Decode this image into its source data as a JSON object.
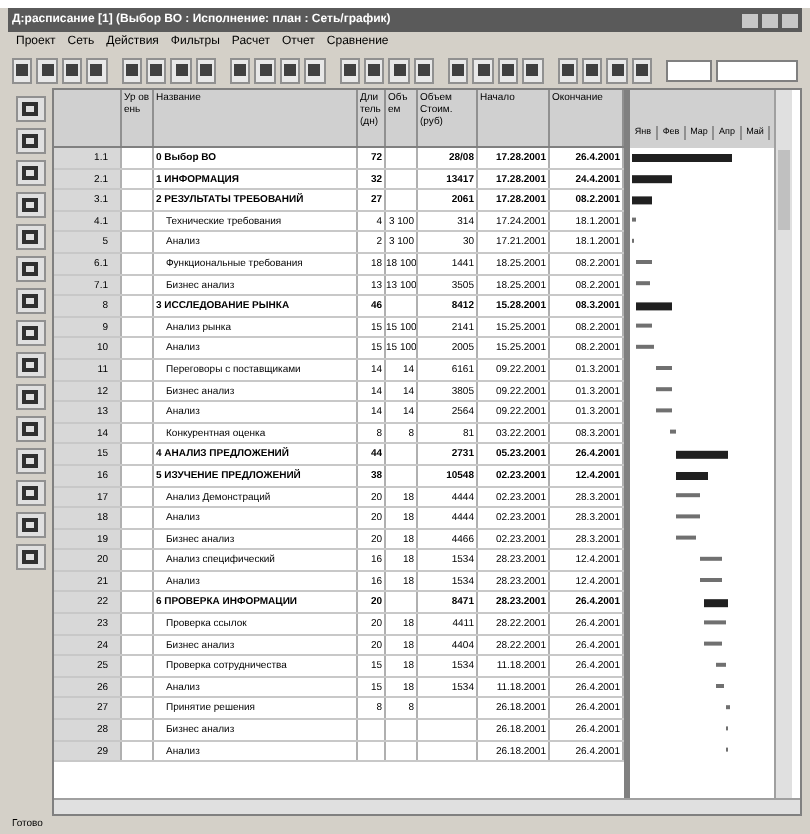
{
  "window": {
    "title": "Д:расписание [1]  (Выбор ВО : Исполнение: план : Сеть/график)"
  },
  "menu": [
    "Проект",
    "Сеть",
    "Действия",
    "Фильтры",
    "Расчет",
    "Отчет",
    "Сравнение"
  ],
  "columns": [
    "",
    "Ур ов ень",
    "Название",
    "Дли тель (дн)",
    "Объ ем",
    "Объем Стоим. (руб)",
    "Начало",
    "Окончание"
  ],
  "gantt_months": [
    "Янв",
    "Фев",
    "Мар",
    "Апр",
    "Май"
  ],
  "rows": [
    {
      "id": "1.1",
      "name": "0 Выбор ВО",
      "kind": "summary",
      "dur": "72",
      "vol": "",
      "cost": "28/08",
      "start": "17.28.2001",
      "end": "26.4.2001"
    },
    {
      "id": "2.1",
      "name": "1 ИНФОРМАЦИЯ",
      "kind": "summary",
      "dur": "32",
      "vol": "",
      "cost": "13417",
      "start": "17.28.2001",
      "end": "24.4.2001"
    },
    {
      "id": "3.1",
      "name": "2 РЕЗУЛЬТАТЫ ТРЕБОВАНИЙ",
      "kind": "summary",
      "dur": "27",
      "vol": "",
      "cost": "2061",
      "start": "17.28.2001",
      "end": "08.2.2001"
    },
    {
      "id": "4.1",
      "name": "Технические требования",
      "kind": "task",
      "dur": "4",
      "vol": "3 100",
      "cost": "314",
      "start": "17.24.2001",
      "end": "18.1.2001"
    },
    {
      "id": "5",
      "name": "Анализ",
      "kind": "task",
      "dur": "2",
      "vol": "3 100",
      "cost": "30",
      "start": "17.21.2001",
      "end": "18.1.2001"
    },
    {
      "id": "6.1",
      "name": "Функциональные требования",
      "kind": "task",
      "dur": "18",
      "vol": "18 100",
      "cost": "1441",
      "start": "18.25.2001",
      "end": "08.2.2001"
    },
    {
      "id": "7.1",
      "name": "Бизнес анализ",
      "kind": "task",
      "dur": "13",
      "vol": "13 100",
      "cost": "3505",
      "start": "18.25.2001",
      "end": "08.2.2001"
    },
    {
      "id": "8",
      "name": "3 ИССЛЕДОВАНИЕ РЫНКА",
      "kind": "summary",
      "dur": "46",
      "vol": "",
      "cost": "8412",
      "start": "15.28.2001",
      "end": "08.3.2001"
    },
    {
      "id": "9",
      "name": "Анализ рынка",
      "kind": "task",
      "dur": "15",
      "vol": "15 100",
      "cost": "2141",
      "start": "15.25.2001",
      "end": "08.2.2001"
    },
    {
      "id": "10",
      "name": "Анализ",
      "kind": "task",
      "dur": "15",
      "vol": "15 100",
      "cost": "2005",
      "start": "15.25.2001",
      "end": "08.2.2001"
    },
    {
      "id": "11",
      "name": "Переговоры с поставщиками",
      "kind": "task",
      "dur": "14",
      "vol": "14",
      "cost": "6161",
      "start": "09.22.2001",
      "end": "01.3.2001"
    },
    {
      "id": "12",
      "name": "Бизнес анализ",
      "kind": "task",
      "dur": "14",
      "vol": "14",
      "cost": "3805",
      "start": "09.22.2001",
      "end": "01.3.2001"
    },
    {
      "id": "13",
      "name": "Анализ",
      "kind": "task",
      "dur": "14",
      "vol": "14",
      "cost": "2564",
      "start": "09.22.2001",
      "end": "01.3.2001"
    },
    {
      "id": "14",
      "name": "Конкурентная оценка",
      "kind": "task",
      "dur": "8",
      "vol": "8",
      "cost": "81",
      "start": "03.22.2001",
      "end": "08.3.2001"
    },
    {
      "id": "15",
      "name": "4 АНАЛИЗ ПРЕДЛОЖЕНИЙ",
      "kind": "summary",
      "dur": "44",
      "vol": "",
      "cost": "2731",
      "start": "05.23.2001",
      "end": "26.4.2001"
    },
    {
      "id": "16",
      "name": "5 ИЗУЧЕНИЕ ПРЕДЛОЖЕНИЙ",
      "kind": "summary",
      "dur": "38",
      "vol": "",
      "cost": "10548",
      "start": "02.23.2001",
      "end": "12.4.2001"
    },
    {
      "id": "17",
      "name": "Анализ Демонстраций",
      "kind": "task",
      "dur": "20",
      "vol": "18",
      "cost": "4444",
      "start": "02.23.2001",
      "end": "28.3.2001"
    },
    {
      "id": "18",
      "name": "Анализ",
      "kind": "task",
      "dur": "20",
      "vol": "18",
      "cost": "4444",
      "start": "02.23.2001",
      "end": "28.3.2001"
    },
    {
      "id": "19",
      "name": "Бизнес анализ",
      "kind": "task",
      "dur": "20",
      "vol": "18",
      "cost": "4466",
      "start": "02.23.2001",
      "end": "28.3.2001"
    },
    {
      "id": "20",
      "name": "Анализ специфический",
      "kind": "task",
      "dur": "16",
      "vol": "18",
      "cost": "1534",
      "start": "28.23.2001",
      "end": "12.4.2001"
    },
    {
      "id": "21",
      "name": "Анализ",
      "kind": "task",
      "dur": "16",
      "vol": "18",
      "cost": "1534",
      "start": "28.23.2001",
      "end": "12.4.2001"
    },
    {
      "id": "22",
      "name": "6 ПРОВЕРКА ИНФОРМАЦИИ",
      "kind": "summary",
      "dur": "20",
      "vol": "",
      "cost": "8471",
      "start": "28.23.2001",
      "end": "26.4.2001"
    },
    {
      "id": "23",
      "name": "Проверка ссылок",
      "kind": "task",
      "dur": "20",
      "vol": "18",
      "cost": "4411",
      "start": "28.22.2001",
      "end": "26.4.2001"
    },
    {
      "id": "24",
      "name": "Бизнес анализ",
      "kind": "task",
      "dur": "20",
      "vol": "18",
      "cost": "4404",
      "start": "28.22.2001",
      "end": "26.4.2001"
    },
    {
      "id": "25",
      "name": "Проверка сотрудничества",
      "kind": "task",
      "dur": "15",
      "vol": "18",
      "cost": "1534",
      "start": "11.18.2001",
      "end": "26.4.2001"
    },
    {
      "id": "26",
      "name": "Анализ",
      "kind": "task",
      "dur": "15",
      "vol": "18",
      "cost": "1534",
      "start": "11.18.2001",
      "end": "26.4.2001"
    },
    {
      "id": "27",
      "name": "Принятие решения",
      "kind": "task",
      "dur": "8",
      "vol": "8",
      "cost": "",
      "start": "26.18.2001",
      "end": "26.4.2001"
    },
    {
      "id": "28",
      "name": "Бизнес анализ",
      "kind": "task",
      "dur": "",
      "vol": "",
      "cost": "",
      "start": "26.18.2001",
      "end": "26.4.2001"
    },
    {
      "id": "29",
      "name": "Анализ",
      "kind": "task",
      "dur": "",
      "vol": "",
      "cost": "",
      "start": "26.18.2001",
      "end": "26.4.2001"
    }
  ],
  "status_bar": "Готово"
}
